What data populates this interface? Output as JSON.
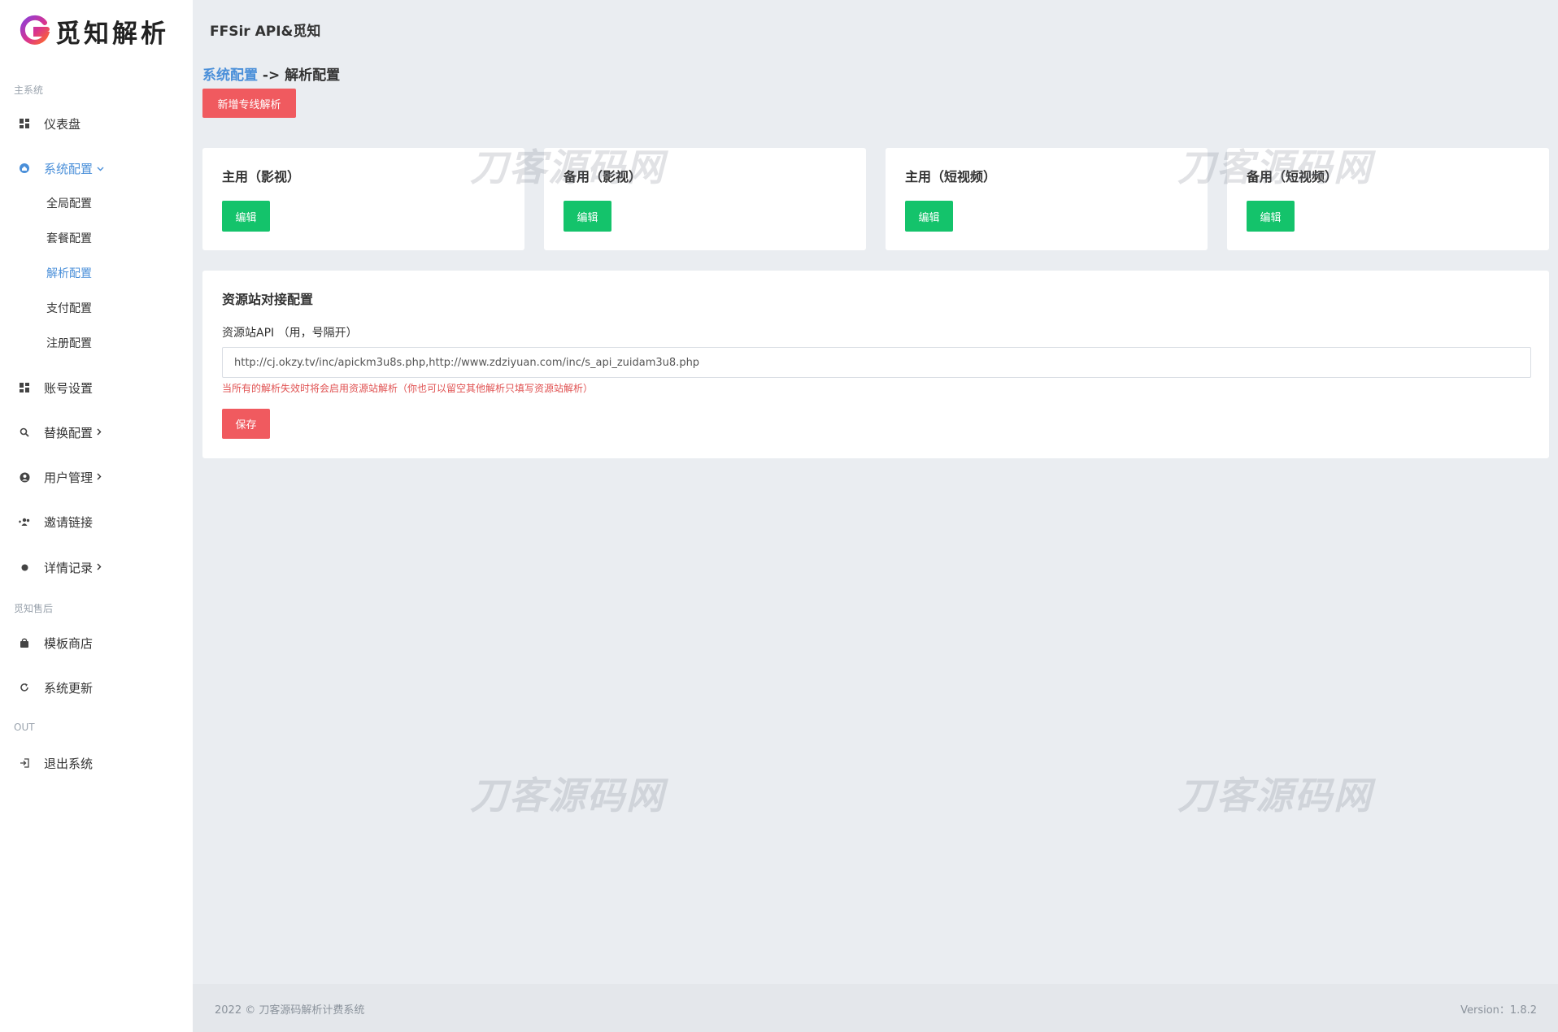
{
  "brand": {
    "logo_text": "觅知解析",
    "colors": {
      "logo_primary": "#8b3fd9",
      "logo_secondary": "#ff6a2b"
    }
  },
  "header": {
    "app_title": "FFSir API&觅知"
  },
  "sidebar": {
    "section_main": "主系统",
    "section_after_sales": "觅知售后",
    "section_out": "OUT",
    "items": [
      {
        "label": "仪表盘",
        "icon": "dashboard-icon"
      },
      {
        "label": "系统配置",
        "icon": "home-icon"
      },
      {
        "label": "账号设置",
        "icon": "grid-icon"
      },
      {
        "label": "替换配置",
        "icon": "search-icon"
      },
      {
        "label": "用户管理",
        "icon": "user-circle-icon"
      },
      {
        "label": "邀请链接",
        "icon": "users-add-icon"
      },
      {
        "label": "详情记录",
        "icon": "dot-icon"
      },
      {
        "label": "模板商店",
        "icon": "bag-icon"
      },
      {
        "label": "系统更新",
        "icon": "refresh-icon"
      },
      {
        "label": "退出系统",
        "icon": "logout-icon"
      }
    ],
    "sub_items": [
      "全局配置",
      "套餐配置",
      "解析配置",
      "支付配置",
      "注册配置"
    ]
  },
  "breadcrumb": {
    "parent": "系统配置",
    "separator": " -> ",
    "current": "解析配置"
  },
  "add_button": "新增专线解析",
  "route_cards": [
    {
      "title": "主用（影视）",
      "button": "编辑"
    },
    {
      "title": "备用（影视）",
      "button": "编辑"
    },
    {
      "title": "主用（短视频）",
      "button": "编辑"
    },
    {
      "title": "备用（短视频）",
      "button": "编辑"
    }
  ],
  "resource": {
    "title": "资源站对接配置",
    "label": "资源站API （用，号隔开）",
    "value": "http://cj.okzy.tv/inc/apickm3u8s.php,http://www.zdziyuan.com/inc/s_api_zuidam3u8.php",
    "hint": "当所有的解析失效时将会启用资源站解析（你也可以留空其他解析只填写资源站解析）",
    "save": "保存"
  },
  "watermark": "刀客源码网",
  "footer": {
    "copyright": "2022 © 刀客源码解析计费系统",
    "version": "Version：1.8.2"
  },
  "colors": {
    "accent_blue": "#4a8fd9",
    "button_red": "#f05a5f",
    "button_green": "#14c36b",
    "hint_red": "#e05252"
  }
}
